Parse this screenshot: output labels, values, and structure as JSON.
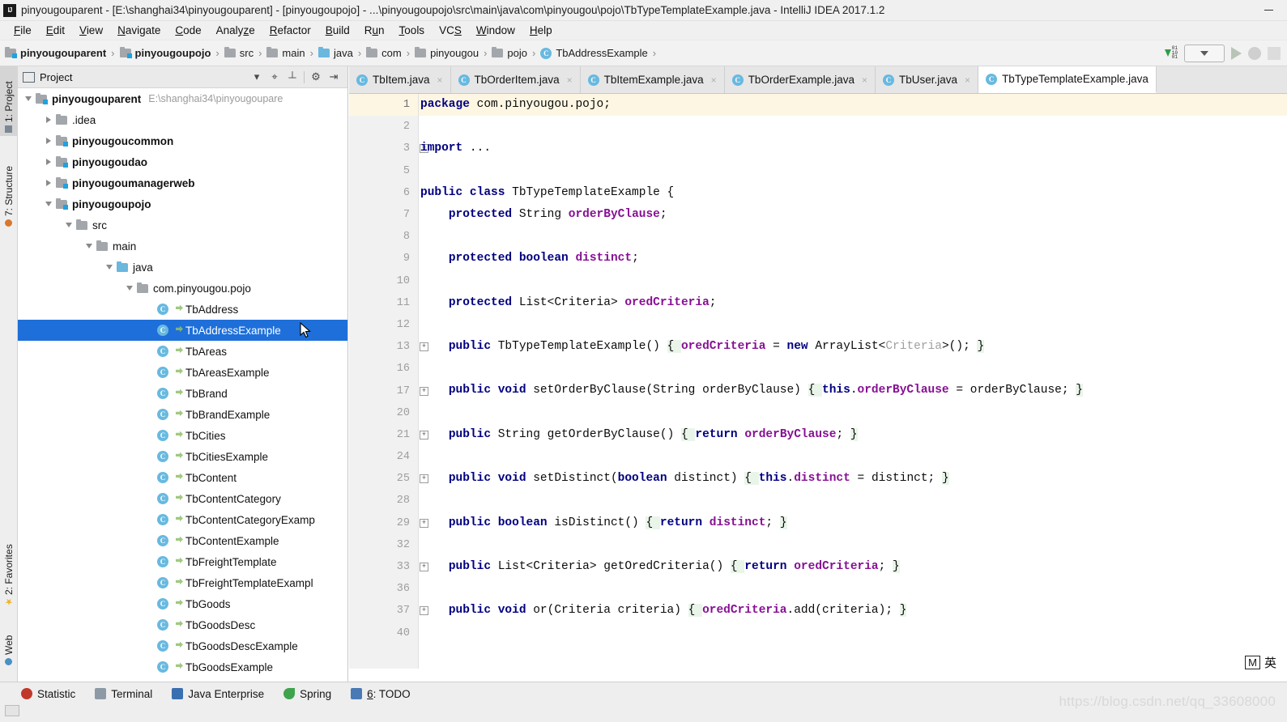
{
  "window": {
    "title": "pinyougouparent - [E:\\shanghai34\\pinyougouparent] - [pinyougoupojo] - ...\\pinyougoupojo\\src\\main\\java\\com\\pinyougou\\pojo\\TbTypeTemplateExample.java - IntelliJ IDEA 2017.1.2",
    "app_icon": "intellij-idea-icon",
    "minimize_label": "─"
  },
  "menubar": {
    "items": [
      {
        "label": "File",
        "mnemonic": "F"
      },
      {
        "label": "Edit",
        "mnemonic": "E"
      },
      {
        "label": "View",
        "mnemonic": "V"
      },
      {
        "label": "Navigate",
        "mnemonic": "N"
      },
      {
        "label": "Code",
        "mnemonic": "C"
      },
      {
        "label": "Analyze",
        "mnemonic": "z"
      },
      {
        "label": "Refactor",
        "mnemonic": "R"
      },
      {
        "label": "Build",
        "mnemonic": "B"
      },
      {
        "label": "Run",
        "mnemonic": "u"
      },
      {
        "label": "Tools",
        "mnemonic": "T"
      },
      {
        "label": "VCS",
        "mnemonic": "S"
      },
      {
        "label": "Window",
        "mnemonic": "W"
      },
      {
        "label": "Help",
        "mnemonic": "H"
      }
    ]
  },
  "breadcrumb": {
    "items": [
      {
        "label": "pinyougouparent",
        "icon": "module-folder-icon",
        "bold": true
      },
      {
        "label": "pinyougoupojo",
        "icon": "module-folder-icon",
        "bold": true
      },
      {
        "label": "src",
        "icon": "folder-icon",
        "bold": false
      },
      {
        "label": "main",
        "icon": "folder-icon",
        "bold": false
      },
      {
        "label": "java",
        "icon": "source-folder-icon",
        "bold": false
      },
      {
        "label": "com",
        "icon": "package-folder-icon",
        "bold": false
      },
      {
        "label": "pinyougou",
        "icon": "package-folder-icon",
        "bold": false
      },
      {
        "label": "pojo",
        "icon": "package-folder-icon",
        "bold": false
      },
      {
        "label": "TbAddressExample",
        "icon": "java-class-icon",
        "bold": false
      }
    ],
    "separator": "›",
    "toolbar": {
      "run_config_icon": "line-numbers-icon",
      "run_config_dropdown": "chevron-down-icon",
      "run_icon": "run-icon",
      "debug_icon": "debug-icon",
      "coverage_icon": "coverage-icon"
    }
  },
  "left_tool_tabs": [
    {
      "label": "1: Project",
      "mnemonic": "1",
      "icon": "project-icon",
      "active": true
    },
    {
      "label": "7: Structure",
      "mnemonic": "7",
      "icon": "structure-icon",
      "active": false
    },
    {
      "label": "2: Favorites",
      "mnemonic": "2",
      "icon": "star-icon",
      "active": false
    },
    {
      "label": "Web",
      "mnemonic": "",
      "icon": "web-icon",
      "active": false
    }
  ],
  "project_panel": {
    "title": "Project",
    "title_icon": "project-view-icon",
    "toolbar": [
      {
        "name": "view-mode-dropdown",
        "glyph": "▾"
      },
      {
        "name": "locate-icon",
        "glyph": "⌖"
      },
      {
        "name": "collapse-all-icon",
        "glyph": "┴"
      },
      {
        "name": "settings-gear-icon",
        "glyph": "⚙"
      },
      {
        "name": "hide-panel-icon",
        "glyph": "⇥"
      }
    ],
    "tree": [
      {
        "label": "pinyougouparent",
        "path": "E:\\shanghai34\\pinyougoupare",
        "indent": 0,
        "twisty": "down",
        "icon": "module-folder-icon",
        "bold": true,
        "selected": false
      },
      {
        "label": ".idea",
        "indent": 1,
        "twisty": "right",
        "icon": "folder-icon",
        "bold": false,
        "selected": false
      },
      {
        "label": "pinyougoucommon",
        "indent": 1,
        "twisty": "right",
        "icon": "module-folder-icon",
        "bold": true,
        "selected": false
      },
      {
        "label": "pinyougoudao",
        "indent": 1,
        "twisty": "right",
        "icon": "module-folder-icon",
        "bold": true,
        "selected": false
      },
      {
        "label": "pinyougoumanagerweb",
        "indent": 1,
        "twisty": "right",
        "icon": "module-folder-icon",
        "bold": true,
        "selected": false
      },
      {
        "label": "pinyougoupojo",
        "indent": 1,
        "twisty": "down",
        "icon": "module-folder-icon",
        "bold": true,
        "selected": false
      },
      {
        "label": "src",
        "indent": 2,
        "twisty": "down",
        "icon": "folder-icon",
        "bold": false,
        "selected": false
      },
      {
        "label": "main",
        "indent": 3,
        "twisty": "down",
        "icon": "folder-icon",
        "bold": false,
        "selected": false
      },
      {
        "label": "java",
        "indent": 4,
        "twisty": "down",
        "icon": "source-folder-icon",
        "bold": false,
        "selected": false
      },
      {
        "label": "com.pinyougou.pojo",
        "indent": 5,
        "twisty": "down",
        "icon": "package-folder-icon",
        "bold": false,
        "selected": false
      },
      {
        "label": "TbAddress",
        "indent": 6,
        "twisty": "",
        "icon": "java-class-icon",
        "bold": false,
        "selected": false
      },
      {
        "label": "TbAddressExample",
        "indent": 6,
        "twisty": "",
        "icon": "java-class-icon",
        "bold": false,
        "selected": true
      },
      {
        "label": "TbAreas",
        "indent": 6,
        "twisty": "",
        "icon": "java-class-icon",
        "bold": false,
        "selected": false
      },
      {
        "label": "TbAreasExample",
        "indent": 6,
        "twisty": "",
        "icon": "java-class-icon",
        "bold": false,
        "selected": false
      },
      {
        "label": "TbBrand",
        "indent": 6,
        "twisty": "",
        "icon": "java-class-icon",
        "bold": false,
        "selected": false
      },
      {
        "label": "TbBrandExample",
        "indent": 6,
        "twisty": "",
        "icon": "java-class-icon",
        "bold": false,
        "selected": false
      },
      {
        "label": "TbCities",
        "indent": 6,
        "twisty": "",
        "icon": "java-class-icon",
        "bold": false,
        "selected": false
      },
      {
        "label": "TbCitiesExample",
        "indent": 6,
        "twisty": "",
        "icon": "java-class-icon",
        "bold": false,
        "selected": false
      },
      {
        "label": "TbContent",
        "indent": 6,
        "twisty": "",
        "icon": "java-class-icon",
        "bold": false,
        "selected": false
      },
      {
        "label": "TbContentCategory",
        "indent": 6,
        "twisty": "",
        "icon": "java-class-icon",
        "bold": false,
        "selected": false
      },
      {
        "label": "TbContentCategoryExamp",
        "indent": 6,
        "twisty": "",
        "icon": "java-class-icon",
        "bold": false,
        "selected": false
      },
      {
        "label": "TbContentExample",
        "indent": 6,
        "twisty": "",
        "icon": "java-class-icon",
        "bold": false,
        "selected": false
      },
      {
        "label": "TbFreightTemplate",
        "indent": 6,
        "twisty": "",
        "icon": "java-class-icon",
        "bold": false,
        "selected": false
      },
      {
        "label": "TbFreightTemplateExampl",
        "indent": 6,
        "twisty": "",
        "icon": "java-class-icon",
        "bold": false,
        "selected": false
      },
      {
        "label": "TbGoods",
        "indent": 6,
        "twisty": "",
        "icon": "java-class-icon",
        "bold": false,
        "selected": false
      },
      {
        "label": "TbGoodsDesc",
        "indent": 6,
        "twisty": "",
        "icon": "java-class-icon",
        "bold": false,
        "selected": false
      },
      {
        "label": "TbGoodsDescExample",
        "indent": 6,
        "twisty": "",
        "icon": "java-class-icon",
        "bold": false,
        "selected": false
      },
      {
        "label": "TbGoodsExample",
        "indent": 6,
        "twisty": "",
        "icon": "java-class-icon",
        "bold": false,
        "selected": false
      }
    ]
  },
  "editor_tabs": [
    {
      "label": "TbItem.java",
      "icon": "java-class-icon",
      "active": false,
      "close": "×"
    },
    {
      "label": "TbOrderItem.java",
      "icon": "java-class-icon",
      "active": false,
      "close": "×"
    },
    {
      "label": "TbItemExample.java",
      "icon": "java-class-icon",
      "active": false,
      "close": "×"
    },
    {
      "label": "TbOrderExample.java",
      "icon": "java-class-icon",
      "active": false,
      "close": "×"
    },
    {
      "label": "TbUser.java",
      "icon": "java-class-icon",
      "active": false,
      "close": "×"
    },
    {
      "label": "TbTypeTemplateExample.java",
      "icon": "java-class-icon",
      "active": true,
      "close": ""
    }
  ],
  "editor": {
    "file": "TbTypeTemplateExample.java",
    "lines": [
      {
        "num": "1",
        "fold": "",
        "current": true,
        "tokens": [
          {
            "t": "package ",
            "c": "kw"
          },
          {
            "t": "com.pinyougou.pojo;",
            "c": "pl"
          }
        ]
      },
      {
        "num": "2",
        "fold": "",
        "current": false,
        "tokens": []
      },
      {
        "num": "3",
        "fold": "+",
        "current": false,
        "tokens": [
          {
            "t": "import ",
            "c": "kw"
          },
          {
            "t": "...",
            "c": "pl"
          }
        ]
      },
      {
        "num": "5",
        "fold": "",
        "current": false,
        "tokens": []
      },
      {
        "num": "6",
        "fold": "",
        "current": false,
        "tokens": [
          {
            "t": "public class ",
            "c": "kw"
          },
          {
            "t": "TbTypeTemplateExample {",
            "c": "pl"
          }
        ]
      },
      {
        "num": "7",
        "fold": "",
        "current": false,
        "tokens": [
          {
            "t": "    ",
            "c": "pl"
          },
          {
            "t": "protected ",
            "c": "kw"
          },
          {
            "t": "String ",
            "c": "pl"
          },
          {
            "t": "orderByClause",
            "c": "fld"
          },
          {
            "t": ";",
            "c": "pl"
          }
        ]
      },
      {
        "num": "8",
        "fold": "",
        "current": false,
        "tokens": []
      },
      {
        "num": "9",
        "fold": "",
        "current": false,
        "tokens": [
          {
            "t": "    ",
            "c": "pl"
          },
          {
            "t": "protected boolean ",
            "c": "kw"
          },
          {
            "t": "distinct",
            "c": "fld"
          },
          {
            "t": ";",
            "c": "pl"
          }
        ]
      },
      {
        "num": "10",
        "fold": "",
        "current": false,
        "tokens": []
      },
      {
        "num": "11",
        "fold": "",
        "current": false,
        "tokens": [
          {
            "t": "    ",
            "c": "pl"
          },
          {
            "t": "protected ",
            "c": "kw"
          },
          {
            "t": "List<Criteria> ",
            "c": "pl"
          },
          {
            "t": "oredCriteria",
            "c": "fld"
          },
          {
            "t": ";",
            "c": "pl"
          }
        ]
      },
      {
        "num": "12",
        "fold": "",
        "current": false,
        "tokens": []
      },
      {
        "num": "13",
        "fold": "+",
        "current": false,
        "tokens": [
          {
            "t": "    ",
            "c": "pl"
          },
          {
            "t": "public ",
            "c": "kw"
          },
          {
            "t": "TbTypeTemplateExample() ",
            "c": "pl"
          },
          {
            "t": "{ ",
            "c": "hl"
          },
          {
            "t": "oredCriteria",
            "c": "fld"
          },
          {
            "t": " = ",
            "c": "pl"
          },
          {
            "t": "new ",
            "c": "kw"
          },
          {
            "t": "ArrayList<",
            "c": "pl"
          },
          {
            "t": "Criteria",
            "c": "gen"
          },
          {
            "t": ">(); ",
            "c": "pl"
          },
          {
            "t": "}",
            "c": "hl"
          }
        ]
      },
      {
        "num": "16",
        "fold": "",
        "current": false,
        "tokens": []
      },
      {
        "num": "17",
        "fold": "+",
        "current": false,
        "tokens": [
          {
            "t": "    ",
            "c": "pl"
          },
          {
            "t": "public void ",
            "c": "kw"
          },
          {
            "t": "setOrderByClause(String orderByClause) ",
            "c": "pl"
          },
          {
            "t": "{ ",
            "c": "hl"
          },
          {
            "t": "this",
            "c": "kw"
          },
          {
            "t": ".",
            "c": "pl"
          },
          {
            "t": "orderByClause",
            "c": "fld"
          },
          {
            "t": " = orderByClause; ",
            "c": "pl"
          },
          {
            "t": "}",
            "c": "hl"
          }
        ]
      },
      {
        "num": "20",
        "fold": "",
        "current": false,
        "tokens": []
      },
      {
        "num": "21",
        "fold": "+",
        "current": false,
        "tokens": [
          {
            "t": "    ",
            "c": "pl"
          },
          {
            "t": "public ",
            "c": "kw"
          },
          {
            "t": "String getOrderByClause() ",
            "c": "pl"
          },
          {
            "t": "{ ",
            "c": "hl"
          },
          {
            "t": "return ",
            "c": "kw"
          },
          {
            "t": "orderByClause",
            "c": "fld"
          },
          {
            "t": "; ",
            "c": "pl"
          },
          {
            "t": "}",
            "c": "hl"
          }
        ]
      },
      {
        "num": "24",
        "fold": "",
        "current": false,
        "tokens": []
      },
      {
        "num": "25",
        "fold": "+",
        "current": false,
        "tokens": [
          {
            "t": "    ",
            "c": "pl"
          },
          {
            "t": "public void ",
            "c": "kw"
          },
          {
            "t": "setDistinct(",
            "c": "pl"
          },
          {
            "t": "boolean ",
            "c": "kw"
          },
          {
            "t": "distinct) ",
            "c": "pl"
          },
          {
            "t": "{ ",
            "c": "hl"
          },
          {
            "t": "this",
            "c": "kw"
          },
          {
            "t": ".",
            "c": "pl"
          },
          {
            "t": "distinct",
            "c": "fld"
          },
          {
            "t": " = distinct; ",
            "c": "pl"
          },
          {
            "t": "}",
            "c": "hl"
          }
        ]
      },
      {
        "num": "28",
        "fold": "",
        "current": false,
        "tokens": []
      },
      {
        "num": "29",
        "fold": "+",
        "current": false,
        "tokens": [
          {
            "t": "    ",
            "c": "pl"
          },
          {
            "t": "public boolean ",
            "c": "kw"
          },
          {
            "t": "isDistinct() ",
            "c": "pl"
          },
          {
            "t": "{ ",
            "c": "hl"
          },
          {
            "t": "return ",
            "c": "kw"
          },
          {
            "t": "distinct",
            "c": "fld"
          },
          {
            "t": "; ",
            "c": "pl"
          },
          {
            "t": "}",
            "c": "hl"
          }
        ]
      },
      {
        "num": "32",
        "fold": "",
        "current": false,
        "tokens": []
      },
      {
        "num": "33",
        "fold": "+",
        "current": false,
        "tokens": [
          {
            "t": "    ",
            "c": "pl"
          },
          {
            "t": "public ",
            "c": "kw"
          },
          {
            "t": "List<Criteria> getOredCriteria() ",
            "c": "pl"
          },
          {
            "t": "{ ",
            "c": "hl"
          },
          {
            "t": "return ",
            "c": "kw"
          },
          {
            "t": "oredCriteria",
            "c": "fld"
          },
          {
            "t": "; ",
            "c": "pl"
          },
          {
            "t": "}",
            "c": "hl"
          }
        ]
      },
      {
        "num": "36",
        "fold": "",
        "current": false,
        "tokens": []
      },
      {
        "num": "37",
        "fold": "+",
        "current": false,
        "tokens": [
          {
            "t": "    ",
            "c": "pl"
          },
          {
            "t": "public void ",
            "c": "kw"
          },
          {
            "t": "or(Criteria criteria) ",
            "c": "pl"
          },
          {
            "t": "{ ",
            "c": "hl"
          },
          {
            "t": "oredCriteria",
            "c": "fld"
          },
          {
            "t": ".add(criteria); ",
            "c": "pl"
          },
          {
            "t": "}",
            "c": "hl"
          }
        ]
      },
      {
        "num": "40",
        "fold": "",
        "current": false,
        "tokens": []
      }
    ]
  },
  "ime": {
    "mode_badge": "M",
    "language": "英"
  },
  "statusbar": {
    "items": [
      {
        "label": "Statistic",
        "icon": "statistic-icon",
        "color": "#c0392b",
        "mnemonic": ""
      },
      {
        "label": "Terminal",
        "icon": "terminal-icon",
        "color": "#8d9aa6",
        "mnemonic": ""
      },
      {
        "label": "Java Enterprise",
        "icon": "java-enterprise-icon",
        "color": "#3a6fb0",
        "mnemonic": ""
      },
      {
        "label": "Spring",
        "icon": "spring-icon",
        "color": "#3fa34d",
        "mnemonic": ""
      },
      {
        "label": "6: TODO",
        "icon": "todo-icon",
        "color": "#4a7ab5",
        "mnemonic": "6"
      }
    ],
    "watermark": "https://blog.csdn.net/qq_33608000"
  }
}
